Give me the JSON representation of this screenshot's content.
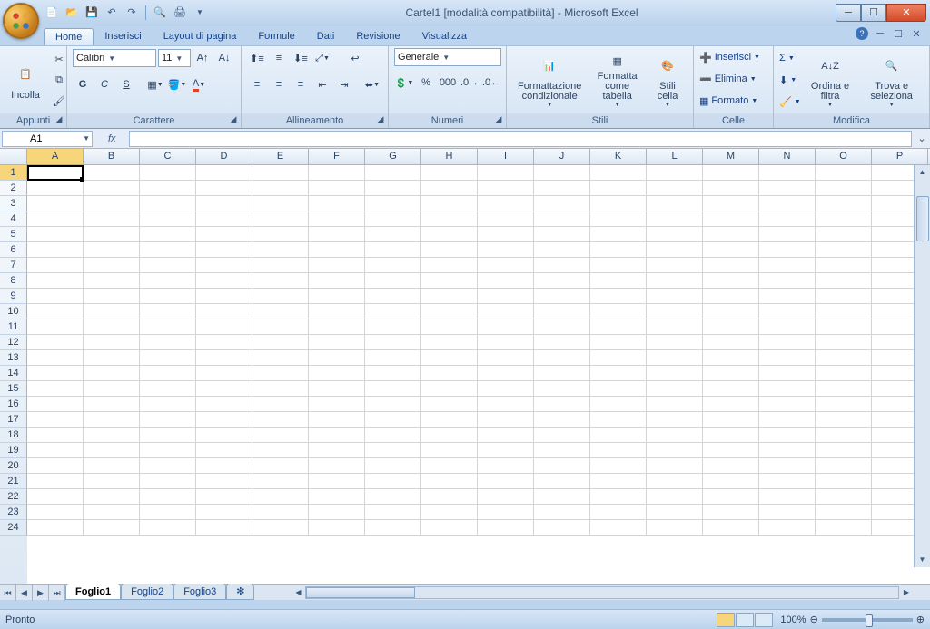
{
  "title": "Cartel1 [modalità compatibilità] - Microsoft Excel",
  "tabs": [
    "Home",
    "Inserisci",
    "Layout di pagina",
    "Formule",
    "Dati",
    "Revisione",
    "Visualizza"
  ],
  "active_tab": 0,
  "ribbon": {
    "clipboard": {
      "label": "Appunti",
      "paste": "Incolla"
    },
    "font": {
      "label": "Carattere",
      "name": "Calibri",
      "size": "11",
      "bold": "G",
      "italic": "C",
      "underline": "S"
    },
    "alignment": {
      "label": "Allineamento"
    },
    "number": {
      "label": "Numeri",
      "format": "Generale"
    },
    "styles": {
      "label": "Stili",
      "cond": "Formattazione condizionale",
      "table": "Formatta come tabella",
      "cell": "Stili cella"
    },
    "cells": {
      "label": "Celle",
      "insert": "Inserisci",
      "delete": "Elimina",
      "format": "Formato"
    },
    "editing": {
      "label": "Modifica",
      "sort": "Ordina e filtra",
      "find": "Trova e seleziona"
    }
  },
  "namebox": "A1",
  "columns": [
    "A",
    "B",
    "C",
    "D",
    "E",
    "F",
    "G",
    "H",
    "I",
    "J",
    "K",
    "L",
    "M",
    "N",
    "O",
    "P"
  ],
  "rows": 24,
  "sheets": [
    "Foglio1",
    "Foglio2",
    "Foglio3"
  ],
  "active_sheet": 0,
  "status": "Pronto",
  "zoom": "100%"
}
